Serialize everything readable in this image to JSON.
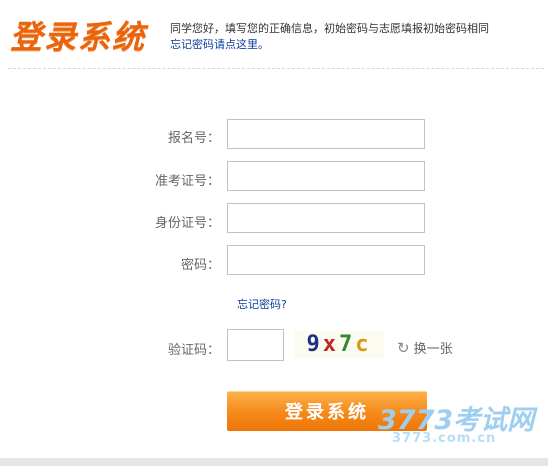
{
  "page_title": "登录系统",
  "notice": {
    "text": "同学您好，填写您的正确信息，初始密码与志愿填报初始密码相同",
    "link_text": "忘记密码请点这里。"
  },
  "form": {
    "fields": [
      {
        "label": "报名号：",
        "value": ""
      },
      {
        "label": "准考证号：",
        "value": ""
      },
      {
        "label": "身份证号：",
        "value": ""
      },
      {
        "label": "密码：",
        "value": ""
      }
    ],
    "forgot_password": "忘记密码?",
    "captcha": {
      "label": "验证码：",
      "value": "",
      "chars": [
        "9",
        "x",
        "7",
        "c"
      ],
      "char_colors": [
        "#1e2f86",
        "#c1281f",
        "#2e8a2e",
        "#d79a12"
      ],
      "refresh_label": "换一张",
      "refresh_icon": "refresh-icon"
    },
    "submit_label": "登录系统"
  },
  "watermark": {
    "brand": "3773考试网",
    "url": "3773.com.cn"
  },
  "colors": {
    "accent": "#e9640d",
    "link": "#0b3e9c",
    "button": "#f5891a"
  }
}
